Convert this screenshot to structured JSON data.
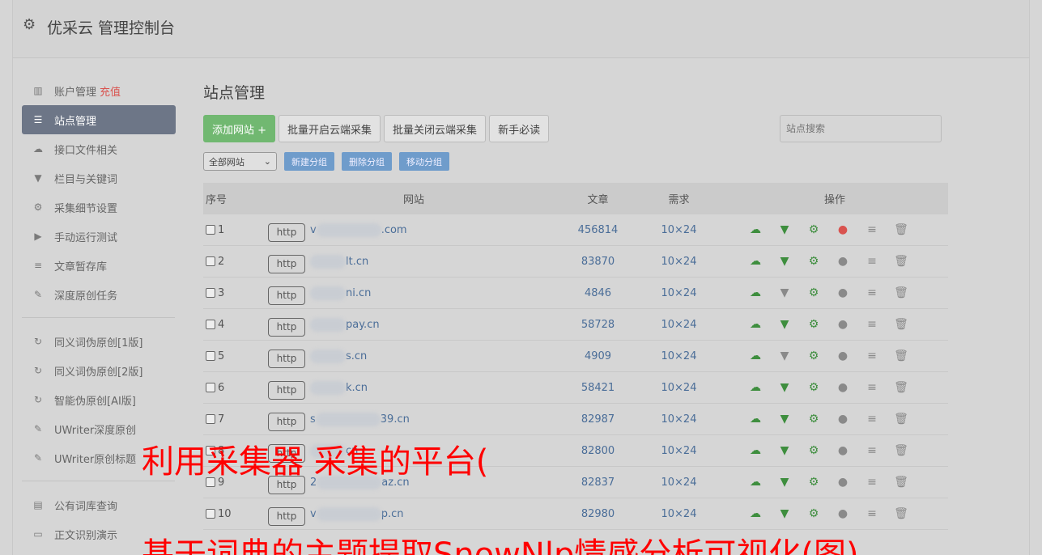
{
  "header": {
    "title": "优采云 管理控制台"
  },
  "sidebar": {
    "group1": [
      {
        "label": "账户管理",
        "badge": "充值",
        "icon": "bar-chart-icon"
      },
      {
        "label": "站点管理",
        "icon": "server-icon",
        "active": true
      },
      {
        "label": "接口文件相关",
        "icon": "cloud-upload-icon"
      },
      {
        "label": "栏目与关键词",
        "icon": "filter-icon"
      },
      {
        "label": "采集细节设置",
        "icon": "gears-icon"
      },
      {
        "label": "手动运行测试",
        "icon": "play-circle-icon"
      },
      {
        "label": "文章暂存库",
        "icon": "database-icon"
      },
      {
        "label": "深度原创任务",
        "icon": "edit-icon"
      }
    ],
    "group2": [
      {
        "label": "同义词伪原创[1版]",
        "icon": "refresh-icon"
      },
      {
        "label": "同义词伪原创[2版]",
        "icon": "refresh-icon"
      },
      {
        "label": "智能伪原创[AI版]",
        "icon": "refresh-icon"
      },
      {
        "label": "UWriter深度原创",
        "icon": "edit-icon"
      },
      {
        "label": "UWriter原创标题",
        "icon": "edit-icon"
      }
    ],
    "group3": [
      {
        "label": "公有词库查询",
        "icon": "book-icon"
      },
      {
        "label": "正文识别演示",
        "icon": "monitor-icon"
      }
    ]
  },
  "main": {
    "title": "站点管理",
    "buttons": {
      "add": "添加网站 +",
      "batch_on": "批量开启云端采集",
      "batch_off": "批量关闭云端采集",
      "guide": "新手必读"
    },
    "search_placeholder": "站点搜索",
    "group_select": "全部网站",
    "group_buttons": {
      "new": "新建分组",
      "delete": "删除分组",
      "move": "移动分组"
    },
    "table": {
      "headers": {
        "no": "序号",
        "site": "网站",
        "articles": "文章",
        "need": "需求",
        "ops": "操作"
      },
      "rows": [
        {
          "no": "1",
          "http": "http",
          "prefix": "v",
          "suffix": ".com",
          "articles": "456814",
          "need": "10×24",
          "filter_active": true,
          "play_red": true
        },
        {
          "no": "2",
          "http": "http",
          "prefix": "",
          "suffix": "lt.cn",
          "articles": "83870",
          "need": "10×24",
          "filter_active": true,
          "play_red": false
        },
        {
          "no": "3",
          "http": "http",
          "prefix": "",
          "suffix": "ni.cn",
          "articles": "4846",
          "need": "10×24",
          "filter_active": false,
          "play_red": false
        },
        {
          "no": "4",
          "http": "http",
          "prefix": "",
          "suffix": "pay.cn",
          "articles": "58728",
          "need": "10×24",
          "filter_active": true,
          "play_red": false
        },
        {
          "no": "5",
          "http": "http",
          "prefix": "",
          "suffix": "s.cn",
          "articles": "4909",
          "need": "10×24",
          "filter_active": false,
          "play_red": false
        },
        {
          "no": "6",
          "http": "http",
          "prefix": "",
          "suffix": "k.cn",
          "articles": "58421",
          "need": "10×24",
          "filter_active": true,
          "play_red": false
        },
        {
          "no": "7",
          "http": "http",
          "prefix": "s",
          "suffix": "39.cn",
          "articles": "82987",
          "need": "10×24",
          "filter_active": true,
          "play_red": false
        },
        {
          "no": "8",
          "http": "http",
          "prefix": "",
          "suffix": "cn",
          "articles": "82800",
          "need": "10×24",
          "filter_active": true,
          "play_red": false
        },
        {
          "no": "9",
          "http": "http",
          "prefix": "2",
          "suffix": "az.cn",
          "articles": "82837",
          "need": "10×24",
          "filter_active": true,
          "play_red": false
        },
        {
          "no": "10",
          "http": "http",
          "prefix": "v",
          "suffix": "p.cn",
          "articles": "82980",
          "need": "10×24",
          "filter_active": true,
          "play_red": false
        }
      ]
    }
  },
  "overlay": {
    "line1": "利用采集器 采集的平台(",
    "line2": "基于词典的主题提取SnowNlp情感分析可视化(图)"
  }
}
